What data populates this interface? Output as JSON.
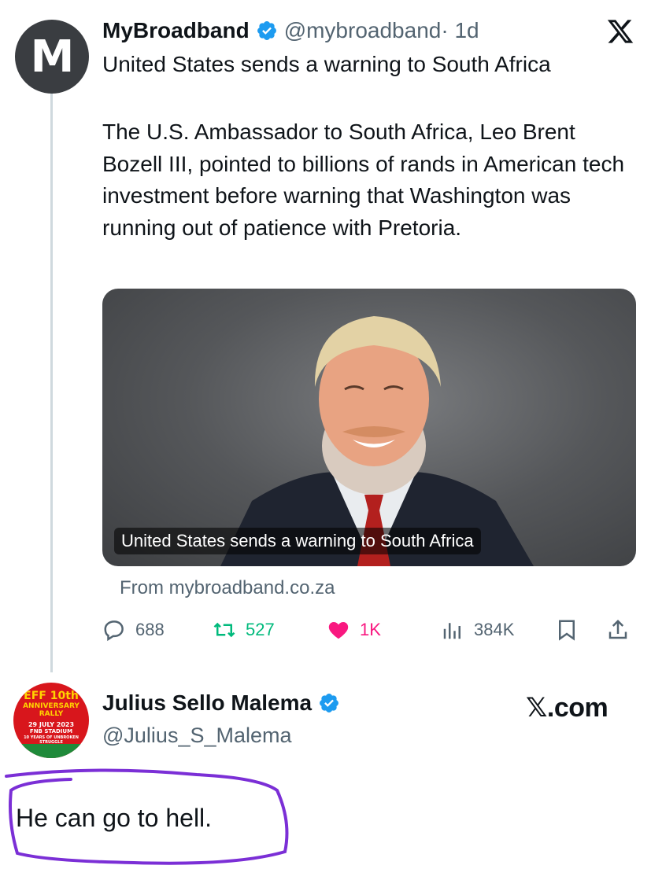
{
  "tweet": {
    "avatar_letter": "M",
    "author_name": "MyBroadband",
    "author_handle": "@mybroadband",
    "time": "· 1d",
    "title": "United States sends a warning to South Africa",
    "body": "The U.S. Ambassador to South Africa, Leo Brent Bozell III, pointed to billions of rands in American tech investment before warning that Washington was running out of patience with Pretoria.",
    "card": {
      "caption": "United States sends a warning to South Africa",
      "source": "From mybroadband.co.za"
    },
    "actions": {
      "replies": "688",
      "retweets": "527",
      "likes": "1K",
      "views": "384K"
    }
  },
  "reply": {
    "author_name": "Julius Sello Malema",
    "author_handle": "@Julius_S_Malema",
    "watermark": "𝕏.com",
    "text": "He can go to hell.",
    "avatar_text": {
      "line1": "EFF 10th",
      "line2": "ANNIVERSARY",
      "line3": "RALLY",
      "line4": "29 JULY 2023",
      "line5": "FNB STADIUM",
      "line6": "10 YEARS OF UNBROKEN STRUGGLE"
    }
  },
  "colors": {
    "verified": "#1d9bf0",
    "retweet": "#00ba7c",
    "like": "#f91880",
    "muted": "#536471",
    "annotation": "#7b2fd6",
    "eff_red": "#d8161c"
  },
  "icons": [
    "x-logo-icon",
    "verified-badge-icon",
    "reply-icon",
    "retweet-icon",
    "heart-icon",
    "views-icon",
    "bookmark-icon",
    "share-icon"
  ]
}
